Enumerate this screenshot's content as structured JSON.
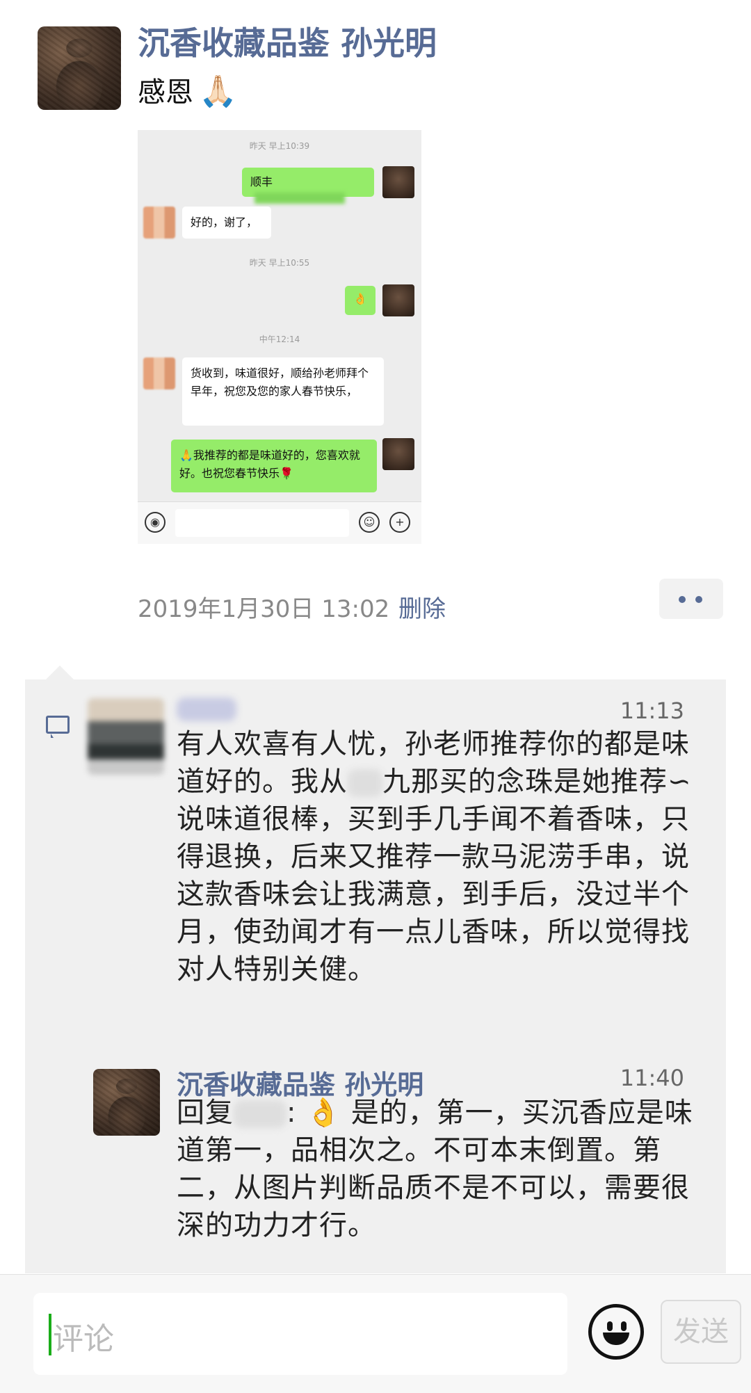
{
  "post": {
    "author": "沉香收藏品鉴 孙光明",
    "text": "感恩",
    "emoji": "🙏🏻",
    "time": "2019年1月30日 13:02",
    "delete_label": "删除"
  },
  "chat_screenshot": {
    "time1": "昨天 早上10:39",
    "msg1": "顺丰",
    "msg2": "好的，谢了，",
    "time2": "昨天 早上10:55",
    "msg3": "👌",
    "time3": "中午12:14",
    "msg4": "货收到，味道很好，顺给孙老师拜个早年，祝您及您的家人春节快乐，",
    "msg5": "🙏我推荐的都是味道好的，您喜欢就好。也祝您春节快乐🌹"
  },
  "comments": [
    {
      "time": "11:13",
      "text_part1": "有人欢喜有人忧，孙老师推荐你的都是味道好的。我从",
      "text_part2": "九那买的念珠是她推荐∽说味道很棒，买到手几手闻不着香味，只得退换，后来又推荐一款马泥涝手串，说这款香味会让我满意，到手后，没过半个月，使劲闻才有一点儿香味，所以觉得找对人特别关健。"
    },
    {
      "author": "沉香收藏品鉴 孙光明",
      "time": "11:40",
      "reply_prefix": "回复",
      "text": "是的，第一，买沉香应是味道第一，品相次之。不可本末倒置。第二，从图片判断品质不是不可以，需要很深的功力才行。",
      "emoji": "👌"
    }
  ],
  "comment_bar": {
    "placeholder": "评论",
    "send_label": "发送"
  }
}
